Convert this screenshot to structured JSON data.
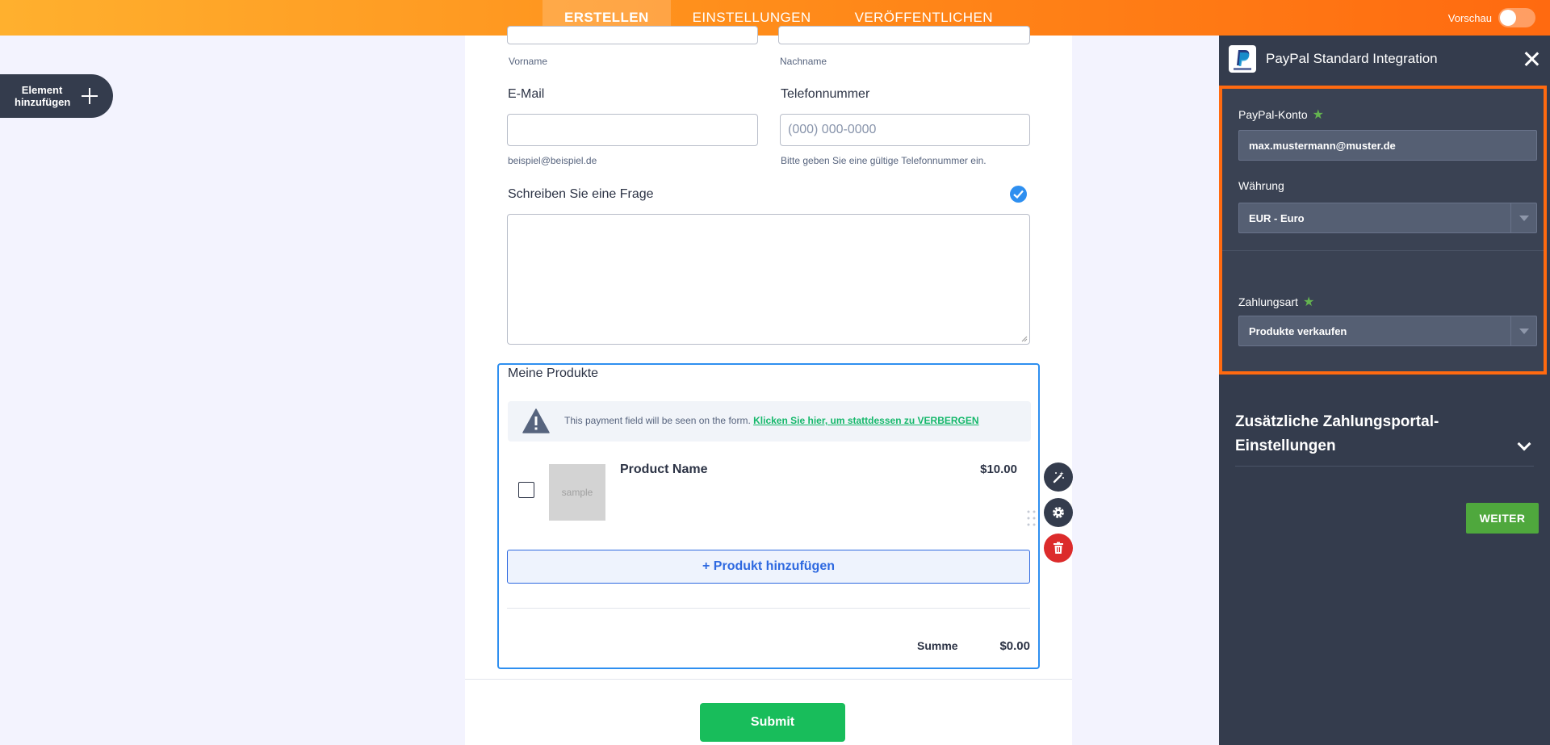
{
  "topbar": {
    "tabs": [
      {
        "label": "ERSTELLEN"
      },
      {
        "label": "EINSTELLUNGEN"
      },
      {
        "label": "VERÖFFENTLICHEN"
      }
    ],
    "preview_label": "Vorschau"
  },
  "add_element": {
    "label_line1": "Element",
    "label_line2": "hinzufügen"
  },
  "form": {
    "name": {
      "first_sublabel": "Vorname",
      "last_sublabel": "Nachname"
    },
    "email": {
      "label": "E-Mail",
      "sublabel": "beispiel@beispiel.de"
    },
    "phone": {
      "label": "Telefonnummer",
      "placeholder": "(000) 000-0000",
      "sublabel": "Bitte geben Sie eine gültige Telefonnummer ein."
    },
    "question": {
      "label": "Schreiben Sie eine Frage"
    },
    "products": {
      "title": "Meine Produkte",
      "notice_text": "This payment field will be seen on the form.",
      "notice_link": "Klicken Sie hier, um stattdessen zu VERBERGEN",
      "item": {
        "image_label": "sample",
        "name": "Product Name",
        "price": "$10.00"
      },
      "add_label": "+ Produkt hinzufügen",
      "sum_label": "Summe",
      "sum_value": "$0.00"
    },
    "submit_label": "Submit"
  },
  "panel": {
    "title": "PayPal Standard Integration",
    "account": {
      "label": "PayPal-Konto",
      "value": "max.mustermann@muster.de"
    },
    "currency": {
      "label": "Währung",
      "value": "EUR - Euro"
    },
    "payment_type": {
      "label": "Zahlungsart",
      "value": "Produkte verkaufen"
    },
    "extra_settings": {
      "line1": "Zusätzliche Zahlungsportal-",
      "line2": "Einstellungen"
    },
    "next_label": "WEITER"
  },
  "colors": {
    "accent": "#ff6a10",
    "panel_bg": "#343c4d",
    "submit": "#18bd5b",
    "link_green": "#15b86b",
    "form_blue": "#2e8ff0"
  }
}
